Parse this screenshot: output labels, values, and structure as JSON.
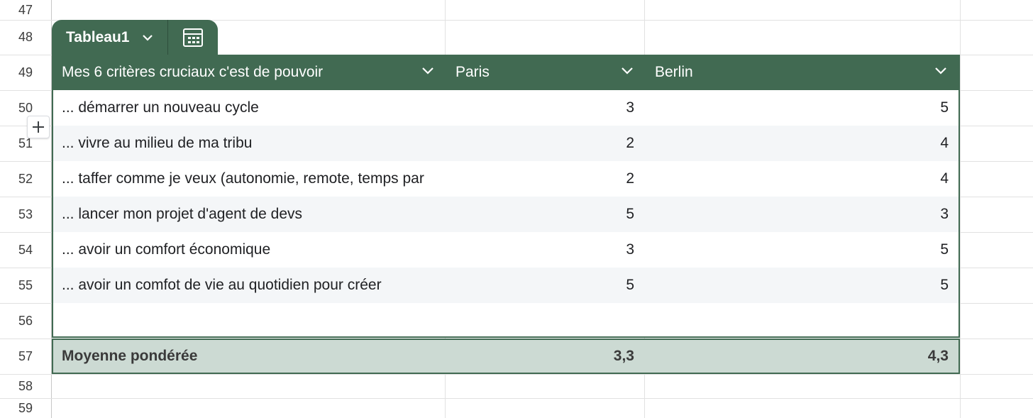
{
  "row_numbers": [
    "47",
    "48",
    "49",
    "50",
    "51",
    "52",
    "53",
    "54",
    "55",
    "56",
    "57",
    "58",
    "59"
  ],
  "table": {
    "name": "Tableau1",
    "headers": [
      "Mes 6 critères cruciaux c'est de pouvoir",
      "Paris",
      "Berlin"
    ],
    "rows": [
      {
        "criterion": "... démarrer un nouveau cycle",
        "paris": "3",
        "berlin": "5"
      },
      {
        "criterion": "... vivre au milieu de ma tribu",
        "paris": "2",
        "berlin": "4"
      },
      {
        "criterion": "... taffer comme je veux (autonomie, remote, temps par",
        "paris": "2",
        "berlin": "4"
      },
      {
        "criterion": "... lancer mon projet d'agent de devs",
        "paris": "5",
        "berlin": "3"
      },
      {
        "criterion": "... avoir un comfort économique",
        "paris": "3",
        "berlin": "5"
      },
      {
        "criterion": "... avoir un comfot de vie au quotidien pour créer",
        "paris": "5",
        "berlin": "5"
      }
    ],
    "footer": {
      "label": "Moyenne pondérée",
      "paris": "3,3",
      "berlin": "4,3"
    }
  },
  "colors": {
    "header_green": "#416a52",
    "footer_green": "#ccdad3",
    "alt_row": "#f4f6f8"
  },
  "icons": {
    "tab_dropdown": "chevron-down-icon",
    "calc": "calculator-icon",
    "column_menu": "chevron-down-icon",
    "add": "plus-icon"
  }
}
